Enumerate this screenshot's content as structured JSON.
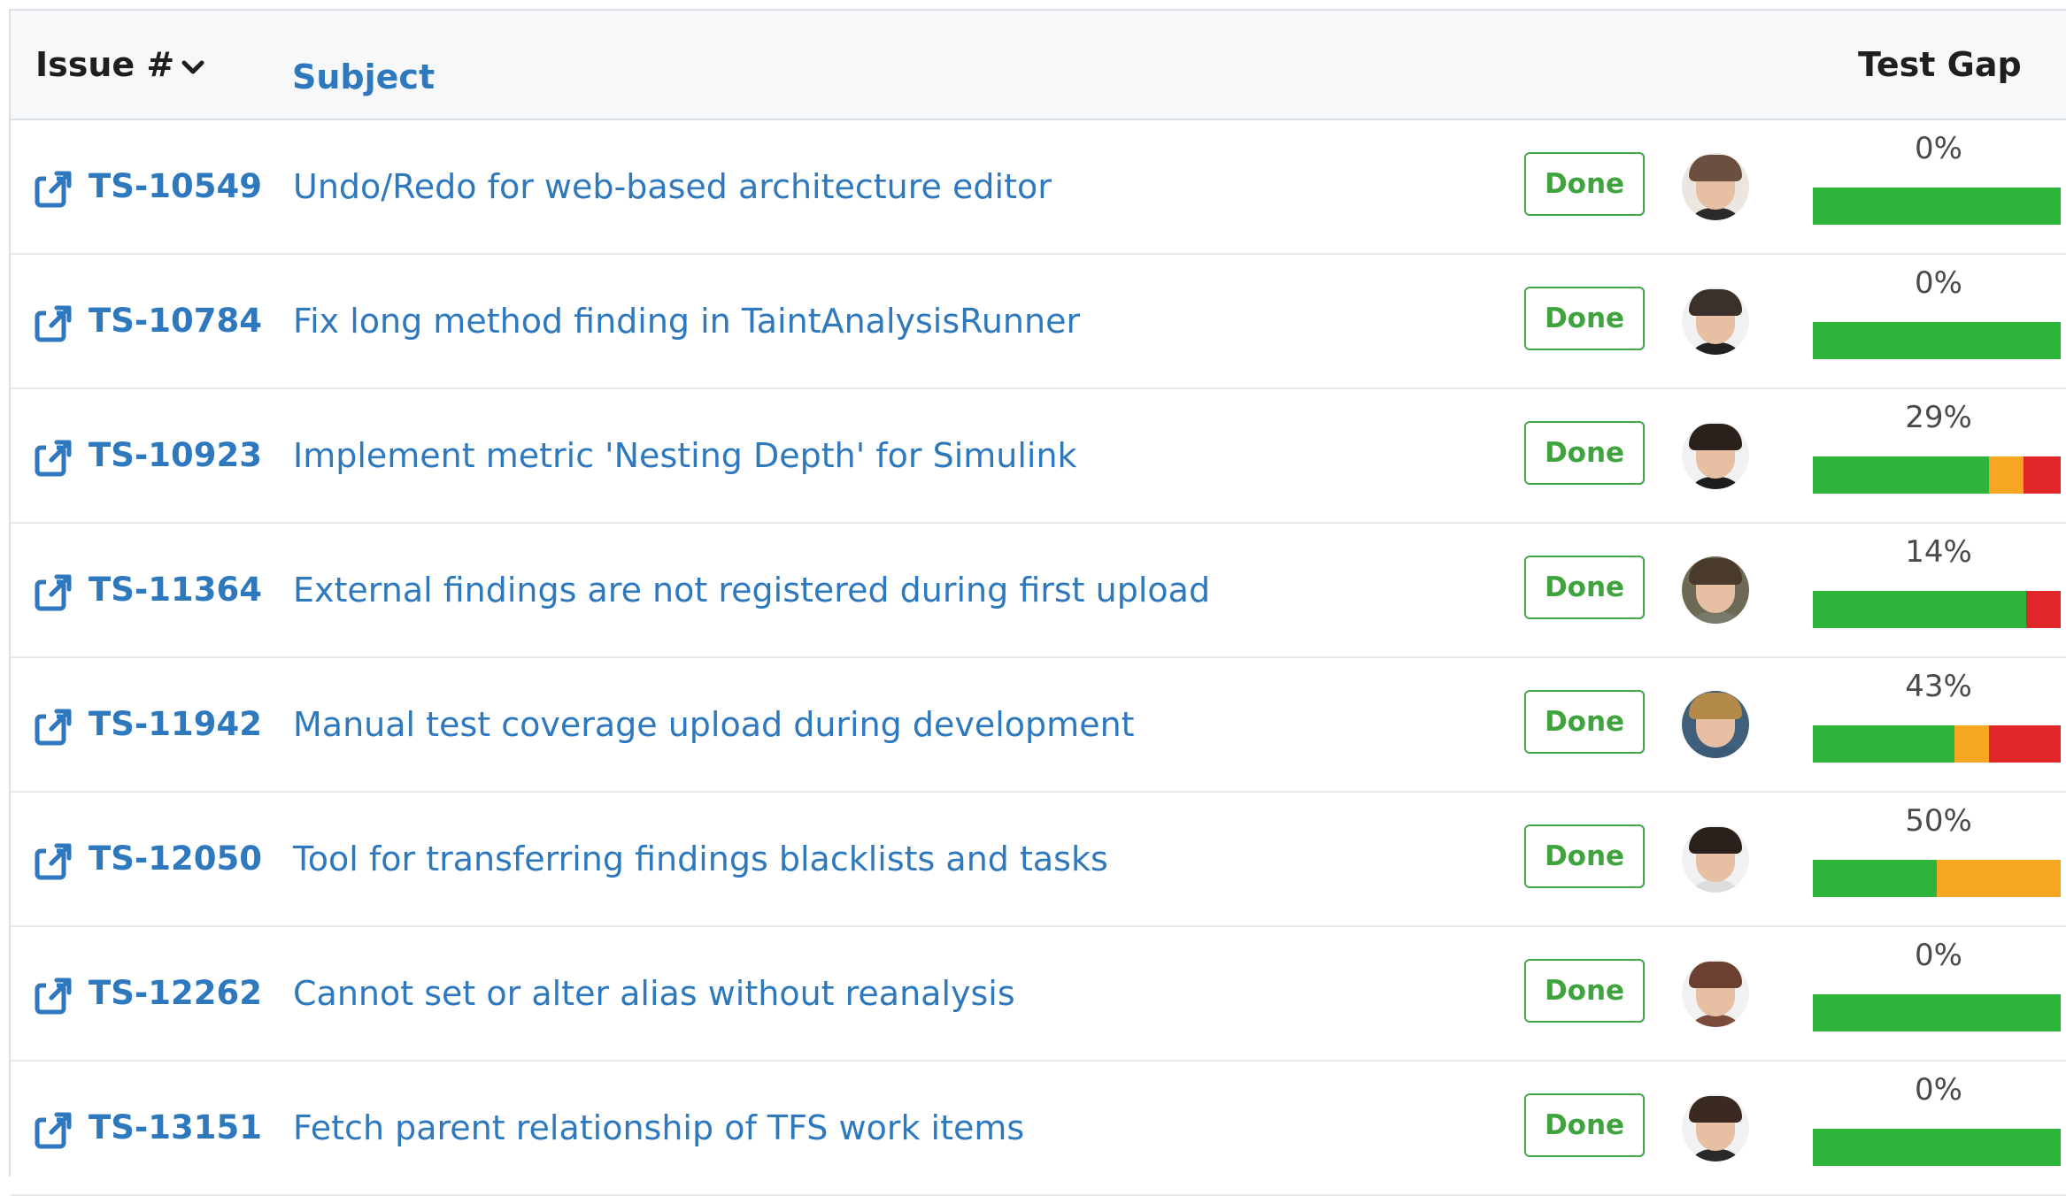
{
  "colors": {
    "link": "#2e78bd",
    "done_green": "#3fa33f",
    "bar_green": "#2db53b",
    "bar_orange": "#f7a623",
    "bar_red": "#e0262b"
  },
  "table": {
    "columns": {
      "issue": "Issue #",
      "subject": "Subject",
      "test_gap": "Test Gap"
    },
    "sort_icon": "chevron-down-icon",
    "row_icon": "external-link-icon",
    "rows": [
      {
        "id": "TS-10549",
        "subject": "Undo/Redo for web-based architecture editor",
        "status": "Done",
        "gap_label": "0%",
        "segments": {
          "green": 100,
          "orange": 0,
          "red": 0
        },
        "avatar": {
          "bg": "#ece6e0",
          "hair": "#6b5040",
          "shirt": "#2a2a2a"
        }
      },
      {
        "id": "TS-10784",
        "subject": "Fix long method finding in TaintAnalysisRunner",
        "status": "Done",
        "gap_label": "0%",
        "segments": {
          "green": 100,
          "orange": 0,
          "red": 0
        },
        "avatar": {
          "bg": "#f1f1f1",
          "hair": "#3b302a",
          "shirt": "#222222"
        }
      },
      {
        "id": "TS-10923",
        "subject": "Implement metric 'Nesting Depth' for Simulink",
        "status": "Done",
        "gap_label": "29%",
        "segments": {
          "green": 71,
          "orange": 14,
          "red": 15
        },
        "avatar": {
          "bg": "#f1f1f1",
          "hair": "#2a211c",
          "shirt": "#1d1d1d"
        }
      },
      {
        "id": "TS-11364",
        "subject": "External findings are not registered during first upload",
        "status": "Done",
        "gap_label": "14%",
        "segments": {
          "green": 86,
          "orange": 0,
          "red": 14
        },
        "avatar": {
          "bg": "#6c6a55",
          "hair": "#4a3a2c",
          "shirt": "#7a7a6a"
        }
      },
      {
        "id": "TS-11942",
        "subject": "Manual test coverage upload during development",
        "status": "Done",
        "gap_label": "43%",
        "segments": {
          "green": 57,
          "orange": 14,
          "red": 29
        },
        "avatar": {
          "bg": "#3f5f7a",
          "hair": "#b48a4a",
          "shirt": "#3a5a7a"
        }
      },
      {
        "id": "TS-12050",
        "subject": "Tool for transferring findings blacklists and tasks",
        "status": "Done",
        "gap_label": "50%",
        "segments": {
          "green": 50,
          "orange": 50,
          "red": 0
        },
        "avatar": {
          "bg": "#f1f1f1",
          "hair": "#2a211c",
          "shirt": "#dddddd"
        }
      },
      {
        "id": "TS-12262",
        "subject": "Cannot set or alter alias without reanalysis",
        "status": "Done",
        "gap_label": "0%",
        "segments": {
          "green": 100,
          "orange": 0,
          "red": 0
        },
        "avatar": {
          "bg": "#f1f1f1",
          "hair": "#6b4030",
          "shirt": "#7a4a3a"
        }
      },
      {
        "id": "TS-13151",
        "subject": "Fetch parent relationship of TFS work items",
        "status": "Done",
        "gap_label": "0%",
        "segments": {
          "green": 100,
          "orange": 0,
          "red": 0
        },
        "avatar": {
          "bg": "#f1f1f1",
          "hair": "#3b2a22",
          "shirt": "#2a2a2a"
        }
      }
    ]
  }
}
